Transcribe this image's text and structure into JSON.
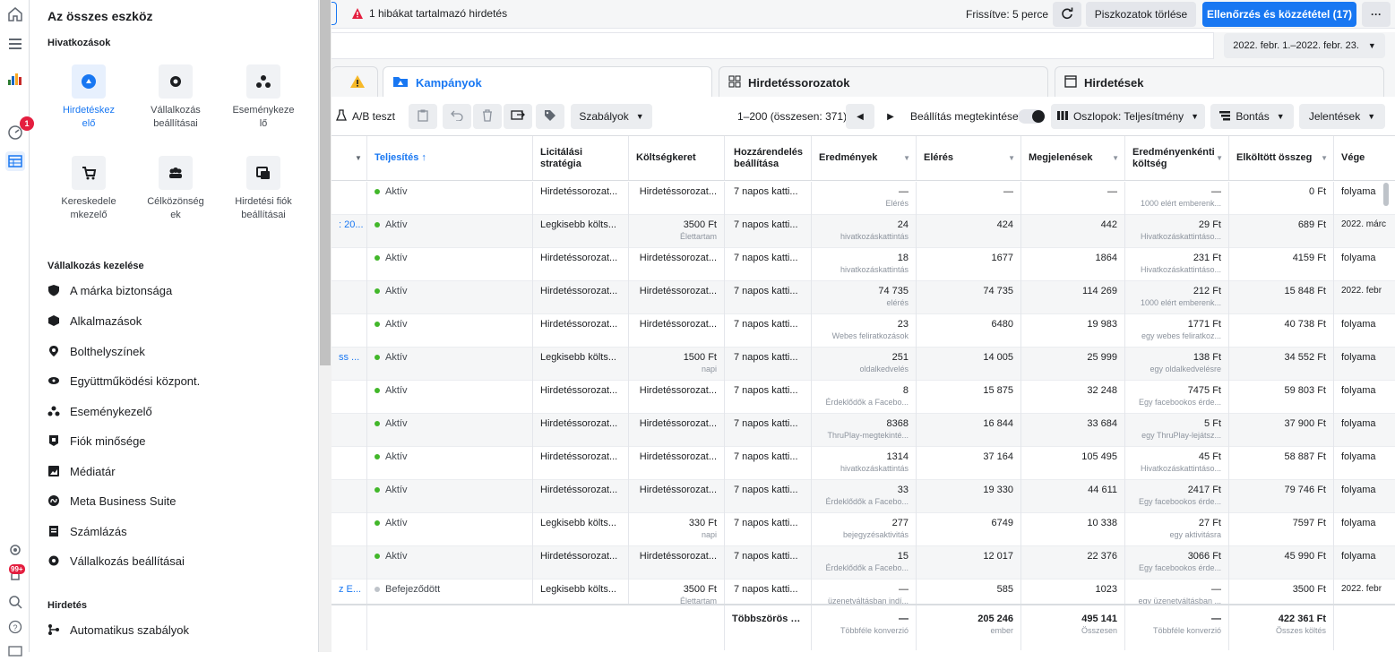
{
  "drawer": {
    "title": "Az összes eszköz",
    "shortcuts_title": "Hivatkozások",
    "shortcuts": [
      {
        "label": "Hirdetéskezelő",
        "icon": "ads-manager-icon"
      },
      {
        "label": "Vállalkozás beállításai",
        "icon": "gear-icon"
      },
      {
        "label": "Eseménykezelő",
        "icon": "events-manager-icon"
      },
      {
        "label": "Kereskedelemkezelő",
        "icon": "cart-icon"
      },
      {
        "label": "Célközönségek",
        "icon": "audience-icon"
      },
      {
        "label": "Hirdetési fiók beállításai",
        "icon": "ad-account-settings-icon"
      }
    ],
    "manage_title": "Vállalkozás kezelése",
    "manage_items": [
      {
        "label": "A márka biztonsága",
        "icon": "shield-icon"
      },
      {
        "label": "Alkalmazások",
        "icon": "cube-icon"
      },
      {
        "label": "Bolthelyszínek",
        "icon": "location-pin-icon"
      },
      {
        "label": "Együttműködési központ.",
        "icon": "handshake-icon"
      },
      {
        "label": "Eseménykezelő",
        "icon": "events-manager-icon"
      },
      {
        "label": "Fiók minősége",
        "icon": "account-quality-icon"
      },
      {
        "label": "Médiatár",
        "icon": "media-library-icon"
      },
      {
        "label": "Meta Business Suite",
        "icon": "meta-icon"
      },
      {
        "label": "Számlázás",
        "icon": "billing-icon"
      },
      {
        "label": "Vállalkozás beállításai",
        "icon": "gear-icon"
      }
    ],
    "ads_title": "Hirdetés",
    "ads_items": [
      {
        "label": "Automatikus szabályok",
        "icon": "rules-icon"
      }
    ]
  },
  "rail": {
    "notification_count": "1",
    "bell_badge": "99+"
  },
  "topbar": {
    "error_text": "1 hibákat tartalmazó hirdetés",
    "refreshed": "Frissítve: 5 perce",
    "discard_label": "Piszkozatok törlése",
    "publish_label": "Ellenőrzés és közzététel (17)",
    "more_label": "···"
  },
  "daterange": "2022. febr. 1.–2022. febr. 23.",
  "tabs": {
    "campaigns": "Kampányok",
    "adsets": "Hirdetéssorozatok",
    "ads": "Hirdetések"
  },
  "toolbar": {
    "ab_test": "A/B teszt",
    "rules": "Szabályok",
    "pagination": "1–200 (összesen: 371)",
    "view_settings": "Beállítás megtekintése",
    "columns": "Oszlopok: Teljesítmény",
    "breakdown": "Bontás",
    "reports": "Jelentések"
  },
  "table": {
    "headers": [
      "Teljesítés ↑",
      "Licitálási stratégia",
      "Költségkeret",
      "Hozzárendelés beállítása",
      "Eredmények",
      "Elérés",
      "Megjelenések",
      "Eredményenkénti költség",
      "Elköltött összeg",
      "Vége"
    ],
    "rows": [
      {
        "name": "",
        "status": "Aktív",
        "bid": "Hirdetéssorozat...",
        "budget": "Hirdetéssorozat...",
        "budget_sub": "",
        "attr": "7 napos katti...",
        "results": "—",
        "results_sub": "Elérés",
        "reach": "—",
        "impr": "—",
        "cpr": "—",
        "cpr_sub": "1000 elért emberenk...",
        "spent": "0 Ft",
        "end": "folyama"
      },
      {
        "name": ": 20...",
        "status": "Aktív",
        "bid": "Legkisebb költs...",
        "budget": "3500 Ft",
        "budget_sub": "Élettartam",
        "attr": "7 napos katti...",
        "results": "24",
        "results_sub": "hivatkozáskattintás",
        "reach": "424",
        "impr": "442",
        "cpr": "29 Ft",
        "cpr_sub": "Hivatkozáskattintáso...",
        "spent": "689 Ft",
        "end": "2022. márc"
      },
      {
        "name": "",
        "status": "Aktív",
        "bid": "Hirdetéssorozat...",
        "budget": "Hirdetéssorozat...",
        "budget_sub": "",
        "attr": "7 napos katti...",
        "results": "18",
        "results_sub": "hivatkozáskattintás",
        "reach": "1677",
        "impr": "1864",
        "cpr": "231 Ft",
        "cpr_sub": "Hivatkozáskattintáso...",
        "spent": "4159 Ft",
        "end": "folyama"
      },
      {
        "name": "",
        "status": "Aktív",
        "bid": "Hirdetéssorozat...",
        "budget": "Hirdetéssorozat...",
        "budget_sub": "",
        "attr": "7 napos katti...",
        "results": "74 735",
        "results_sub": "elérés",
        "reach": "74 735",
        "impr": "114 269",
        "cpr": "212 Ft",
        "cpr_sub": "1000 elért emberenk...",
        "spent": "15 848 Ft",
        "end": "2022. febr"
      },
      {
        "name": "",
        "status": "Aktív",
        "bid": "Hirdetéssorozat...",
        "budget": "Hirdetéssorozat...",
        "budget_sub": "",
        "attr": "7 napos katti...",
        "results": "23",
        "results_sub": "Webes feliratkozások",
        "reach": "6480",
        "impr": "19 983",
        "cpr": "1771 Ft",
        "cpr_sub": "egy webes feliratkoz...",
        "spent": "40 738 Ft",
        "end": "folyama"
      },
      {
        "name": "ss ...",
        "status": "Aktív",
        "bid": "Legkisebb költs...",
        "budget": "1500 Ft",
        "budget_sub": "napi",
        "attr": "7 napos katti...",
        "results": "251",
        "results_sub": "oldalkedvelés",
        "reach": "14 005",
        "impr": "25 999",
        "cpr": "138 Ft",
        "cpr_sub": "egy oldalkedvelésre",
        "spent": "34 552 Ft",
        "end": "folyama"
      },
      {
        "name": "",
        "status": "Aktív",
        "bid": "Hirdetéssorozat...",
        "budget": "Hirdetéssorozat...",
        "budget_sub": "",
        "attr": "7 napos katti...",
        "results": "8",
        "results_sub": "Érdeklődők a Facebo...",
        "reach": "15 875",
        "impr": "32 248",
        "cpr": "7475 Ft",
        "cpr_sub": "Egy facebookos érde...",
        "spent": "59 803 Ft",
        "end": "folyama"
      },
      {
        "name": "",
        "status": "Aktív",
        "bid": "Hirdetéssorozat...",
        "budget": "Hirdetéssorozat...",
        "budget_sub": "",
        "attr": "7 napos katti...",
        "results": "8368",
        "results_sub": "ThruPlay-megtekinté...",
        "reach": "16 844",
        "impr": "33 684",
        "cpr": "5 Ft",
        "cpr_sub": "egy ThruPlay-lejátsz...",
        "spent": "37 900 Ft",
        "end": "folyama"
      },
      {
        "name": "",
        "status": "Aktív",
        "bid": "Hirdetéssorozat...",
        "budget": "Hirdetéssorozat...",
        "budget_sub": "",
        "attr": "7 napos katti...",
        "results": "1314",
        "results_sub": "hivatkozáskattintás",
        "reach": "37 164",
        "impr": "105 495",
        "cpr": "45 Ft",
        "cpr_sub": "Hivatkozáskattintáso...",
        "spent": "58 887 Ft",
        "end": "folyama"
      },
      {
        "name": "",
        "status": "Aktív",
        "bid": "Hirdetéssorozat...",
        "budget": "Hirdetéssorozat...",
        "budget_sub": "",
        "attr": "7 napos katti...",
        "results": "33",
        "results_sub": "Érdeklődők a Facebo...",
        "reach": "19 330",
        "impr": "44 611",
        "cpr": "2417 Ft",
        "cpr_sub": "Egy facebookos érde...",
        "spent": "79 746 Ft",
        "end": "folyama"
      },
      {
        "name": "",
        "status": "Aktív",
        "bid": "Legkisebb költs...",
        "budget": "330 Ft",
        "budget_sub": "napi",
        "attr": "7 napos katti...",
        "results": "277",
        "results_sub": "bejegyzésaktivitás",
        "reach": "6749",
        "impr": "10 338",
        "cpr": "27 Ft",
        "cpr_sub": "egy aktivitásra",
        "spent": "7597 Ft",
        "end": "folyama"
      },
      {
        "name": "",
        "status": "Aktív",
        "bid": "Hirdetéssorozat...",
        "budget": "Hirdetéssorozat...",
        "budget_sub": "",
        "attr": "7 napos katti...",
        "results": "15",
        "results_sub": "Érdeklődők a Facebo...",
        "reach": "12 017",
        "impr": "22 376",
        "cpr": "3066 Ft",
        "cpr_sub": "Egy facebookos érde...",
        "spent": "45 990 Ft",
        "end": "folyama"
      },
      {
        "name": "z E...",
        "status": "Befejeződött",
        "bid": "Legkisebb költs...",
        "budget": "3500 Ft",
        "budget_sub": "Élettartam",
        "attr": "7 napos katti...",
        "results": "—",
        "results_sub": "üzenetváltásban indí...",
        "reach": "585",
        "impr": "1023",
        "cpr": "—",
        "cpr_sub": "egy üzenetváltásban ...",
        "spent": "3500 Ft",
        "end": "2022. febr"
      }
    ],
    "footer": {
      "attr": "Többszörös ho...",
      "results": "—",
      "results_sub": "Többféle konverzió",
      "reach": "205 246",
      "reach_sub": "ember",
      "impr": "495 141",
      "impr_sub": "Összesen",
      "cpr": "—",
      "cpr_sub": "Többféle konverzió",
      "spent": "422 361 Ft",
      "spent_sub": "Összes költés"
    }
  },
  "colors": {
    "accent": "#1877f2",
    "active": "#42b72a",
    "error": "#e41e3f"
  }
}
